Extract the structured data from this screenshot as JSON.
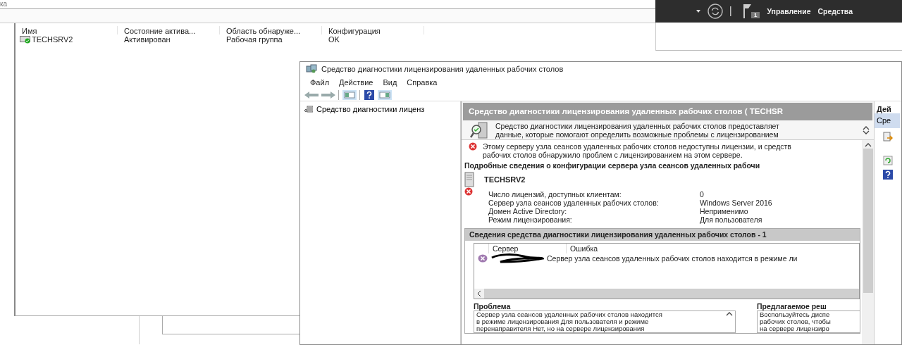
{
  "background_window": {
    "title_fragment": "ка",
    "columns": [
      "Имя",
      "Состояние актива...",
      "Область обнаруже...",
      "Конфигурация"
    ],
    "rows": [
      {
        "cells": [
          "TECHSRV2",
          "Активирован",
          "Рабочая группа",
          "OK"
        ]
      }
    ]
  },
  "server_manager_bar": {
    "notification_count": "1",
    "menu": [
      "Управление",
      "Средства"
    ]
  },
  "window": {
    "title": "Средство диагностики лицензирования удаленных рабочих столов",
    "menu": [
      "Файл",
      "Действие",
      "Вид",
      "Справка"
    ],
    "tree": [
      {
        "label": "Средство диагностики лиценз",
        "selected": false
      }
    ],
    "header": "Средство диагностики лицензирования удаленных рабочих столов ( TECHSR",
    "description": [
      "Средство диагностики лицензирования удаленных рабочих столов предоставляет",
      "данные, которые помогают определить возможные проблемы с лицензированием"
    ],
    "error_message": [
      "Этому серверу узла сеансов удаленных рабочих столов недоступны лицензии, и средств",
      "рабочих столов обнаружило проблем с лицензированием на этом сервере."
    ],
    "details_heading": "Подробные сведения о конфигурации сервера узла сеансов удаленных рабочи",
    "server_name": "TECHSRV2",
    "properties": [
      {
        "label": "Число лицензий, доступных клиентам:",
        "value": "0",
        "error": true
      },
      {
        "label": "Сервер узла сеансов удаленных рабочих столов:",
        "value": "Windows Server 2016",
        "error": false
      },
      {
        "label": "Домен Active Directory:",
        "value": "Неприменимо",
        "error": false
      },
      {
        "label": "Режим лицензирования:",
        "value": "Для пользователя",
        "error": false
      }
    ],
    "findings": {
      "title": "Сведения средства диагностики лицензирования удаленных рабочих столов - 1",
      "columns": [
        "Сервер",
        "Ошибка"
      ],
      "rows": [
        {
          "error": "Сервер узла сеансов удаленных рабочих столов находится в режиме ли"
        }
      ]
    },
    "problem": {
      "label": "Проблема",
      "lines": [
        "Сервер узла сеансов удаленных рабочих столов находится",
        "в режиме лицензирования Для пользователя и режиме",
        "перенаправителя Нет, но на сервере лицензирования"
      ]
    },
    "solution": {
      "label": "Предлагаемое реш",
      "lines": [
        "Воспользуйтесь диспе",
        "рабочих столов, чтобы",
        "на сервере лицензиро"
      ]
    },
    "actions": {
      "header": "Дей",
      "items": [
        {
          "label": "Сре",
          "selected": true
        }
      ]
    }
  }
}
